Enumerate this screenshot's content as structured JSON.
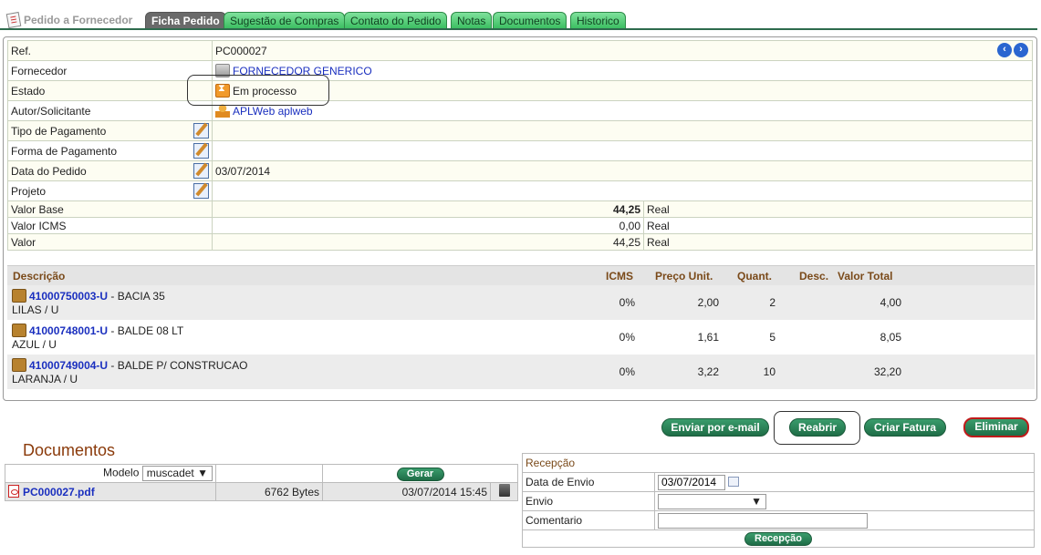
{
  "tabs": {
    "title": "Pedido a Fornecedor",
    "items": [
      "Ficha Pedido",
      "Sugestão de Compras",
      "Contato do Pedido",
      "Notas",
      "Documentos",
      "Historico"
    ]
  },
  "fields": {
    "ref_label": "Ref.",
    "ref_value": "PC000027",
    "fornecedor_label": "Fornecedor",
    "fornecedor_value": "FORNECEDOR GENERICO",
    "estado_label": "Estado",
    "estado_value": "Em processo",
    "autor_label": "Autor/Solicitante",
    "autor_value": "APLWeb aplweb",
    "tipo_pag_label": "Tipo de Pagamento",
    "forma_pag_label": "Forma de Pagamento",
    "data_label": "Data do Pedido",
    "data_value": "03/07/2014",
    "projeto_label": "Projeto",
    "valor_base_label": "Valor Base",
    "valor_base_value": "44,25",
    "valor_base_currency": "Real",
    "valor_icms_label": "Valor ICMS",
    "valor_icms_value": "0,00",
    "valor_icms_currency": "Real",
    "valor_label": "Valor",
    "valor_value": "44,25",
    "valor_currency": "Real"
  },
  "items_header": {
    "descricao": "Descrição",
    "icms": "ICMS",
    "preco": "Preço Unit.",
    "quant": "Quant.",
    "desc": "Desc.",
    "total": "Valor Total"
  },
  "items": [
    {
      "code": "41000750003-U",
      "name": " - BACIA 35",
      "variant": "LILAS / U",
      "icms": "0%",
      "preco": "2,00",
      "quant": "2",
      "total": "4,00"
    },
    {
      "code": "41000748001-U",
      "name": " - BALDE 08 LT",
      "variant": "AZUL / U",
      "icms": "0%",
      "preco": "1,61",
      "quant": "5",
      "total": "8,05"
    },
    {
      "code": "41000749004-U",
      "name": " - BALDE P/ CONSTRUCAO",
      "variant": "LARANJA / U",
      "icms": "0%",
      "preco": "3,22",
      "quant": "10",
      "total": "32,20"
    }
  ],
  "actions": {
    "enviar_email": "Enviar por e-mail",
    "reabrir": "Reabrir",
    "criar_fatura": "Criar Fatura",
    "eliminar": "Eliminar"
  },
  "documents": {
    "title": "Documentos",
    "modelo_label": "Modelo",
    "modelo_value": "muscadet",
    "gerar": "Gerar",
    "file_name": "PC000027.pdf",
    "file_size": "6762 Bytes",
    "file_date": "03/07/2014 15:45"
  },
  "reception": {
    "title": "Recepção",
    "data_envio_label": "Data de Envio",
    "data_envio_value": "03/07/2014",
    "envio_label": "Envio",
    "envio_value": "",
    "comentario_label": "Comentario",
    "comentario_value": "",
    "button": "Recepção"
  }
}
